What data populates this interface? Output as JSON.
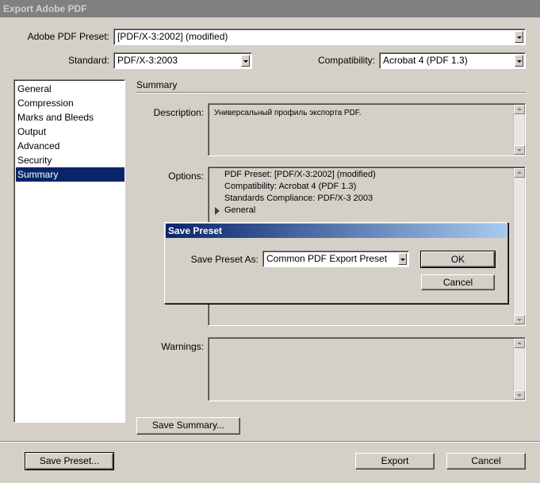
{
  "window": {
    "title": "Export Adobe PDF"
  },
  "preset": {
    "label": "Adobe PDF Preset:",
    "value": "[PDF/X-3:2002] (modified)"
  },
  "standard": {
    "label": "Standard:",
    "value": "PDF/X-3:2003"
  },
  "compatibility": {
    "label": "Compatibility:",
    "value": "Acrobat 4 (PDF 1.3)"
  },
  "sidebar": {
    "items": [
      {
        "label": "General"
      },
      {
        "label": "Compression"
      },
      {
        "label": "Marks and Bleeds"
      },
      {
        "label": "Output"
      },
      {
        "label": "Advanced"
      },
      {
        "label": "Security"
      },
      {
        "label": "Summary"
      }
    ],
    "selected": "Summary"
  },
  "summary": {
    "section_title": "Summary",
    "description_label": "Description:",
    "description_text": "Универсальный профиль экспорта PDF.",
    "options_label": "Options:",
    "options_lines": [
      "PDF Preset: [PDF/X-3:2002] (modified)",
      "Compatibility: Acrobat 4 (PDF 1.3)",
      "Standards Compliance: PDF/X-3 2003",
      "General"
    ],
    "warnings_label": "Warnings:",
    "save_summary_label": "Save Summary..."
  },
  "footer": {
    "save_preset_label": "Save Preset...",
    "export_label": "Export",
    "cancel_label": "Cancel"
  },
  "save_preset_dialog": {
    "title": "Save Preset",
    "field_label": "Save Preset As:",
    "field_value": "Common PDF Export Preset",
    "ok_label": "OK",
    "cancel_label": "Cancel"
  },
  "colors": {
    "window_bg": "#d4d0c8",
    "selection": "#0a246a",
    "title_gradient_end": "#a6caf0"
  }
}
